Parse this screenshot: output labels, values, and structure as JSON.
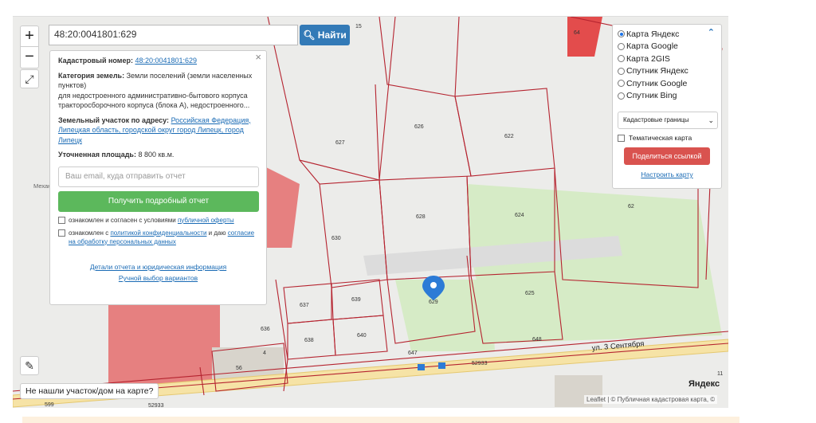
{
  "search": {
    "value": "48:20:0041801:629",
    "button_label": "Найти"
  },
  "zoom": {
    "in_label": "+",
    "out_label": "−"
  },
  "popup": {
    "cadastral_label": "Кадастровый номер:",
    "cadastral_value": "48:20:0041801:629",
    "category_label": "Категория земель:",
    "category_value": "Земли поселений (земли населенных пунктов)",
    "purpose_text": "для недостроенного административно-бытового корпуса тракторосборочного корпуса (блока А), недостроенного...",
    "address_label": "Земельный участок по адресу:",
    "address_value": "Российская Федерация, Липецкая область, городской округ город Липецк, город Липецк",
    "area_label": "Уточненная площадь:",
    "area_value": "8 800 кв.м.",
    "email_placeholder": "Ваш email, куда отправить отчет",
    "get_report_label": "Получить подробный отчет",
    "consent1_text": "ознакомлен и согласен с условиями",
    "consent1_link": "публичной оферты",
    "consent2_text": "ознакомлен с",
    "consent2_link1": "политикой конфиденциальности",
    "consent2_mid": "и даю",
    "consent2_link2": "согласие на обработку персональных данных",
    "details_link": "Детали отчета и юридическая информация",
    "manual_link": "Ручной выбор вариантов",
    "close_label": "×"
  },
  "layers": {
    "options": [
      "Карта Яндекс",
      "Карта Google",
      "Карта 2GIS",
      "Спутник Яндекс",
      "Спутник Google",
      "Спутник Bing"
    ],
    "selected": "Карта Яндекс",
    "select_value": "Кадастровые границы",
    "thematic_label": "Тематическая карта",
    "share_label": "Поделиться ссылкой",
    "configure_link": "Настроить карту"
  },
  "not_found_label": "Не нашли участок/дом на карте?",
  "attribution": "Leaflet | © Публичная кадастровая карта, ©",
  "yandex_logo": "Яндекс",
  "map": {
    "street": "ул. 3 Сентября",
    "partial_label": "Механосборочный цех",
    "parcels": [
      "15",
      "64",
      "626",
      "622",
      "627",
      "628",
      "624",
      "62",
      "630",
      "629",
      "625",
      "637",
      "639",
      "636",
      "638",
      "640",
      "647",
      "648",
      "56",
      "52933",
      "4",
      "11",
      "599",
      "52933"
    ]
  },
  "colors": {
    "accent": "#337ab7",
    "green": "#5cb85c",
    "red": "#d9534f",
    "parcel": "#b5232f"
  }
}
